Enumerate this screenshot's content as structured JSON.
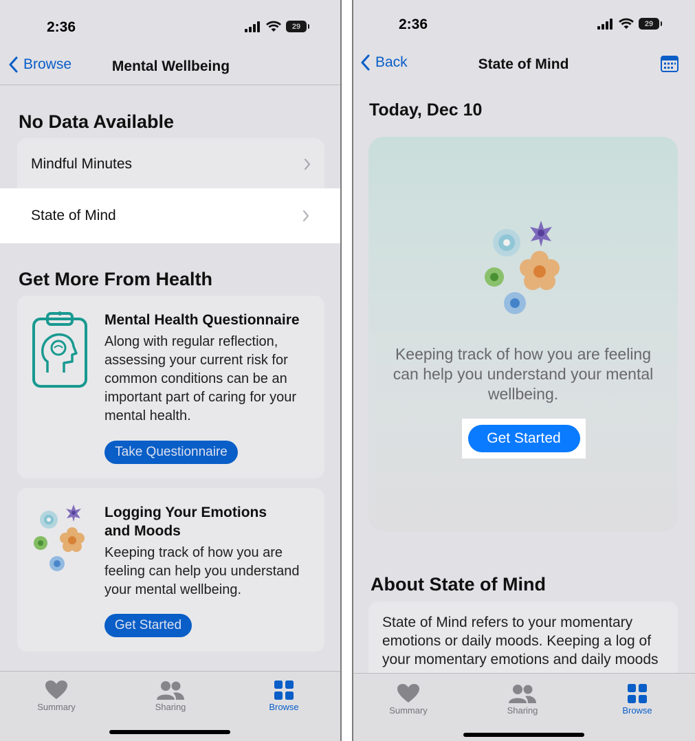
{
  "left": {
    "status": {
      "time": "2:36",
      "battery": "29"
    },
    "nav": {
      "back_label": "Browse",
      "title": "Mental Wellbeing"
    },
    "no_data": {
      "heading": "No Data Available",
      "rows": [
        {
          "label": "Mindful Minutes"
        },
        {
          "label": "State of Mind"
        }
      ]
    },
    "more": {
      "heading": "Get More From Health",
      "cards": [
        {
          "title": "Mental Health Questionnaire",
          "body": "Along with regular reflection, assessing your current risk for common conditions can be an important part of caring for your mental health.",
          "button": "Take Questionnaire",
          "icon": "clipboard-brain-icon"
        },
        {
          "title": "Logging Your Emotions and Moods",
          "body": "Keeping track of how you are feeling can help you understand your mental wellbeing.",
          "button": "Get Started",
          "icon": "flowers-icon"
        }
      ]
    },
    "tabs": [
      {
        "label": "Summary",
        "icon": "heart-icon"
      },
      {
        "label": "Sharing",
        "icon": "people-icon"
      },
      {
        "label": "Browse",
        "icon": "grid-icon",
        "active": true
      }
    ]
  },
  "right": {
    "status": {
      "time": "2:36",
      "battery": "29"
    },
    "nav": {
      "back_label": "Back",
      "title": "State of Mind",
      "action_icon": "calendar-icon"
    },
    "date_heading": "Today, Dec 10",
    "hero": {
      "text": "Keeping track of how you are feeling can help you understand your mental wellbeing.",
      "button": "Get Started"
    },
    "about": {
      "heading": "About State of Mind",
      "body": "State of Mind refers to your momentary emotions or daily moods. Keeping a log of your momentary emotions and daily moods"
    },
    "tabs": [
      {
        "label": "Summary",
        "icon": "heart-icon"
      },
      {
        "label": "Sharing",
        "icon": "people-icon"
      },
      {
        "label": "Browse",
        "icon": "grid-icon",
        "active": true
      }
    ]
  },
  "colors": {
    "accent": "#0a64d4",
    "highlight": "#ffffff",
    "page_bg": "#efeff4"
  }
}
